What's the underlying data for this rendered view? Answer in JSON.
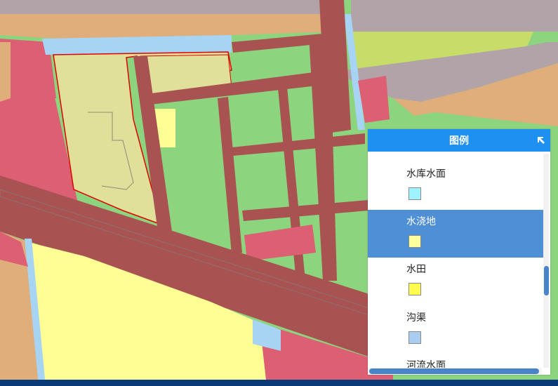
{
  "legend": {
    "title": "图例",
    "collapse_icon": "collapse-arrow-icon",
    "items": [
      {
        "label": "水库水面",
        "color": "#9ff3ff"
      },
      {
        "label": "水浇地",
        "color": "#ffff9e"
      },
      {
        "label": "水田",
        "color": "#fffb4f"
      },
      {
        "label": "沟渠",
        "color": "#a8cdf0"
      },
      {
        "label": "河流水面",
        "color": "#a7c7e7"
      }
    ],
    "selected_index": 1
  },
  "map_colors": {
    "road": "#a95252",
    "construction": "#dd5f73",
    "irrigated_land": "#fffe95",
    "paddy": "#fffb4f",
    "grassland": "#8dd47f",
    "ditch": "#a8d4f3",
    "tan": "#dfae7b",
    "gray": "#b1a3a7",
    "highlighted_parcel": "#e1e09a",
    "highlight_border": "#e00000"
  }
}
